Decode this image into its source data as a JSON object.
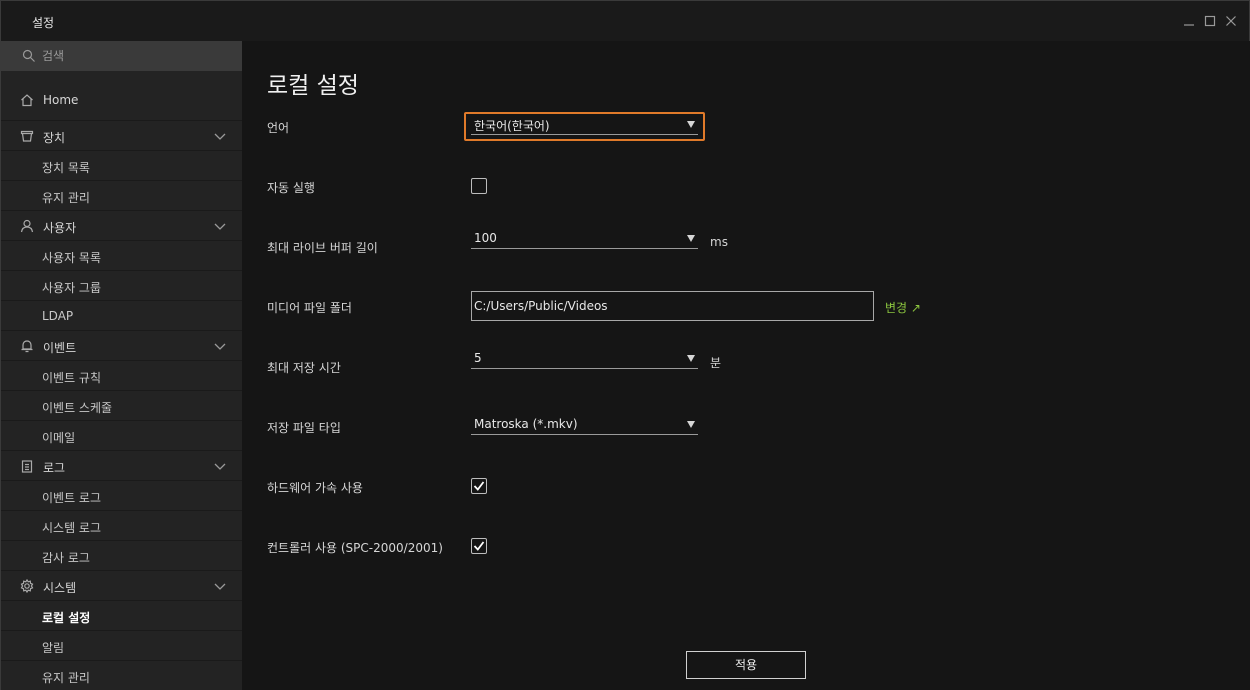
{
  "window": {
    "title": "설정"
  },
  "sidebar": {
    "search_placeholder": "검색",
    "home": {
      "label": "Home",
      "icon": "home-icon"
    },
    "groups": [
      {
        "label": "장치",
        "icon": "device-icon",
        "items": [
          "장치 목록",
          "유지 관리"
        ]
      },
      {
        "label": "사용자",
        "icon": "user-icon",
        "items": [
          "사용자 목록",
          "사용자 그룹",
          "LDAP"
        ]
      },
      {
        "label": "이벤트",
        "icon": "bell-icon",
        "items": [
          "이벤트 규칙",
          "이벤트 스케줄",
          "이메일"
        ]
      },
      {
        "label": "로그",
        "icon": "clipboard-icon",
        "items": [
          "이벤트 로그",
          "시스템 로그",
          "감사 로그"
        ]
      },
      {
        "label": "시스템",
        "icon": "gear-icon",
        "items": [
          "로컬 설정",
          "알림",
          "유지 관리"
        ]
      }
    ],
    "active_item": "로컬 설정"
  },
  "main": {
    "title": "로컬 설정",
    "language": {
      "label": "언어",
      "value": "한국어(한국어)"
    },
    "autostart": {
      "label": "자동 실행",
      "checked": false
    },
    "live_buffer": {
      "label": "최대 라이브 버퍼 길이",
      "value": "100",
      "unit": "ms"
    },
    "media_folder": {
      "label": "미디어 파일 폴더",
      "value": "C:/Users/Public/Videos",
      "change_label": "변경 ↗"
    },
    "max_save_time": {
      "label": "최대 저장 시간",
      "value": "5",
      "unit": "분"
    },
    "save_file_type": {
      "label": "저장 파일 타입",
      "value": "Matroska (*.mkv)"
    },
    "hw_accel": {
      "label": "하드웨어 가속 사용",
      "checked": true
    },
    "controller": {
      "label": "컨트롤러 사용 (SPC-2000/2001)",
      "checked": true
    },
    "apply_label": "적용"
  },
  "colors": {
    "accent_focus": "#e07a2a",
    "link_green": "#8cc63f",
    "sidebar_bg": "#232323",
    "main_bg": "#151515"
  }
}
